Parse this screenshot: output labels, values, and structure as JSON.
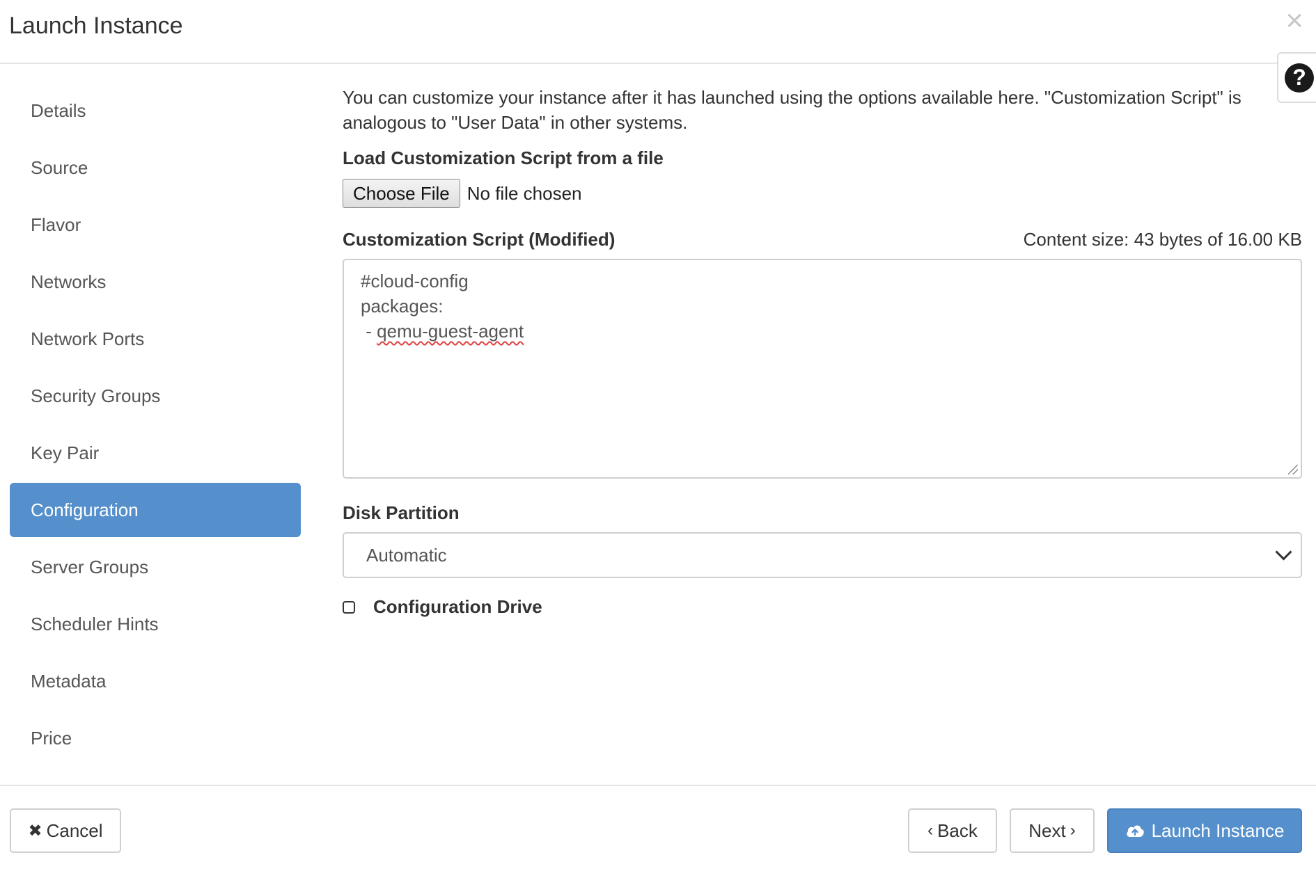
{
  "window": {
    "title": "Launch Instance",
    "close_icon": "×",
    "help_icon": "?"
  },
  "sidebar": {
    "items": [
      {
        "label": "Details",
        "active": false
      },
      {
        "label": "Source",
        "active": false
      },
      {
        "label": "Flavor",
        "active": false
      },
      {
        "label": "Networks",
        "active": false
      },
      {
        "label": "Network Ports",
        "active": false
      },
      {
        "label": "Security Groups",
        "active": false
      },
      {
        "label": "Key Pair",
        "active": false
      },
      {
        "label": "Configuration",
        "active": true
      },
      {
        "label": "Server Groups",
        "active": false
      },
      {
        "label": "Scheduler Hints",
        "active": false
      },
      {
        "label": "Metadata",
        "active": false
      },
      {
        "label": "Price",
        "active": false
      }
    ]
  },
  "main": {
    "description": "You can customize your instance after it has launched using the options available here. \"Customization Script\" is analogous to \"User Data\" in other systems.",
    "load_label": "Load Customization Script from a file",
    "choose_file_label": "Choose File",
    "file_status": "No file chosen",
    "script_label": "Customization Script (Modified)",
    "content_size": "Content size: 43 bytes of 16.00 KB",
    "script_lines": {
      "line1": "#cloud-config",
      "line2": "packages:",
      "line3_prefix": " - ",
      "line3_package": "qemu-guest-agent"
    },
    "disk_partition_label": "Disk Partition",
    "disk_partition_value": "Automatic",
    "config_drive_label": "Configuration Drive",
    "config_drive_checked": false
  },
  "footer": {
    "cancel_icon": "✖",
    "cancel_label": "Cancel",
    "back_icon": "‹",
    "back_label": "Back",
    "next_label": "Next",
    "next_icon": "›",
    "launch_icon": "cloud-upload-icon",
    "launch_label": "Launch Instance"
  },
  "colors": {
    "accent": "#5590cc",
    "sidebar_text": "#555555",
    "border": "#cfcfcf"
  }
}
